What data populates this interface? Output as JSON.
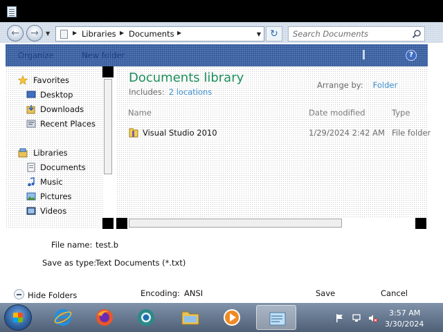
{
  "window": {
    "icon": "notepad-icon"
  },
  "navigation": {
    "back_icon": "back-arrow-icon",
    "forward_icon": "forward-arrow-icon",
    "breadcrumb": [
      "Libraries",
      "Documents"
    ],
    "search_placeholder": "Search Documents"
  },
  "toolbar": {
    "organize": "Organize",
    "new_folder": "New folder"
  },
  "sidebar": {
    "favorites": {
      "label": "Favorites",
      "items": [
        {
          "label": "Desktop",
          "icon": "desktop-icon"
        },
        {
          "label": "Downloads",
          "icon": "downloads-icon"
        },
        {
          "label": "Recent Places",
          "icon": "recent-places-icon"
        }
      ]
    },
    "libraries": {
      "label": "Libraries",
      "items": [
        {
          "label": "Documents",
          "icon": "documents-icon"
        },
        {
          "label": "Music",
          "icon": "music-icon"
        },
        {
          "label": "Pictures",
          "icon": "pictures-icon"
        },
        {
          "label": "Videos",
          "icon": "videos-icon"
        }
      ]
    }
  },
  "content": {
    "title": "Documents library",
    "includes_label": "Includes:",
    "includes_link": "2 locations",
    "arrange_label": "Arrange by:",
    "arrange_value": "Folder",
    "columns": [
      "Name",
      "Date modified",
      "Type"
    ],
    "files": [
      {
        "name": "Visual Studio 2010",
        "date": "1/29/2024 2:42 AM",
        "type": "File folder"
      }
    ]
  },
  "form": {
    "file_name_label": "File name:",
    "file_name_value": "test.b",
    "save_type_label": "Save as type:",
    "save_type_value": "Text Documents (*.txt)",
    "encoding_label": "Encoding:",
    "encoding_value": "ANSI"
  },
  "buttons": {
    "hide_folders": "Hide Folders",
    "save": "Save",
    "cancel": "Cancel"
  },
  "taskbar": {
    "apps": [
      "internet-explorer-icon",
      "firefox-icon",
      "chrome-icon",
      "explorer-icon",
      "media-player-icon",
      "notepad-icon"
    ],
    "time": "3:57 AM",
    "date": "3/30/2024"
  },
  "colors": {
    "accent": "#1e8f5d",
    "link": "#3b8fcf",
    "toolbar": "#4f75b3"
  }
}
